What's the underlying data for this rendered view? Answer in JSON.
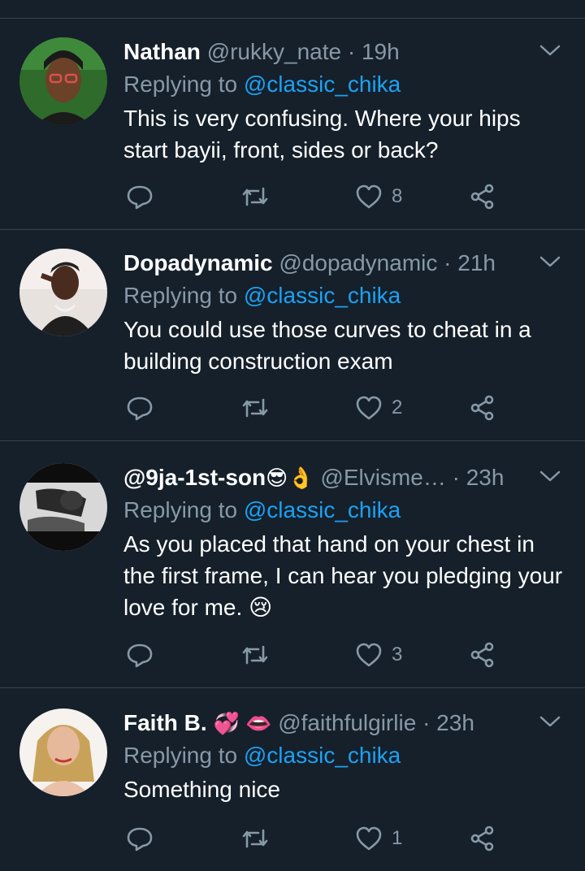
{
  "tweets": [
    {
      "name": "Nathan",
      "name_emoji": "",
      "handle": "@rukky_nate",
      "time": "19h",
      "replying_prefix": "Replying to",
      "mention": "@classic_chika",
      "text": "This is very confusing. Where your hips start bayii, front, sides or back?",
      "likes": "8"
    },
    {
      "name": "Dopadynamic",
      "name_emoji": "",
      "handle": "@dopadynamic",
      "time": "21h",
      "replying_prefix": "Replying to",
      "mention": "@classic_chika",
      "text": "You could use those curves to cheat in a building construction exam",
      "likes": "2"
    },
    {
      "name": "@9ja-1st-son",
      "name_emoji": "😎👌",
      "handle": "@Elvisme…",
      "time": "23h",
      "replying_prefix": "Replying to",
      "mention": "@classic_chika",
      "text": "As you placed that hand on your chest in the first frame, I can hear you pledging your love for me. 😢",
      "likes": "3"
    },
    {
      "name": "Faith B.",
      "name_emoji": "💞 👄",
      "handle": "@faithfulgirlie",
      "time": "23h",
      "replying_prefix": "Replying to",
      "mention": "@classic_chika",
      "text": "Something nice",
      "likes": "1"
    }
  ],
  "separator": "·",
  "colors": {
    "background": "#15202b",
    "divider": "#38444d",
    "muted": "#8899a6",
    "mention": "#1da1f2",
    "text": "#ffffff"
  },
  "icons": [
    "reply-icon",
    "retweet-icon",
    "like-icon",
    "share-icon",
    "chevron-down-icon"
  ]
}
